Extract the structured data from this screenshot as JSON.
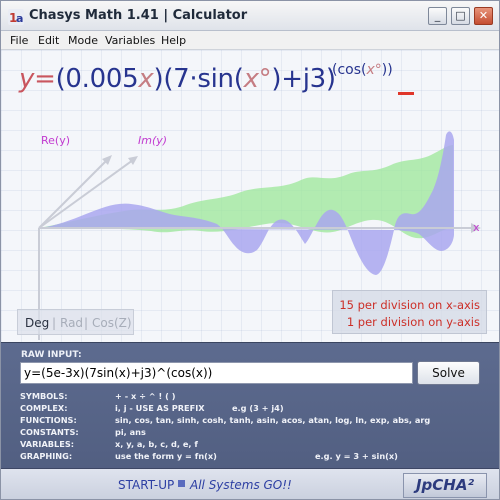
{
  "window": {
    "title": "Chasys Math 1.41 | Calculator",
    "controls": {
      "minimize": "_",
      "maximize": "□",
      "close": "✕"
    }
  },
  "menu": [
    "File",
    "Edit",
    "Mode",
    "Variables",
    "Help"
  ],
  "equation": {
    "y": "y",
    "eq": "=",
    "p1_open": "(0.005",
    "p1_x": "x",
    "p1_close": ")",
    "p2_open": "(7·sin(",
    "p2_x": "x°",
    "p2_close": ")+j3)",
    "exp_open": "(cos(",
    "exp_x": "x°",
    "exp_close": "))"
  },
  "graph": {
    "re_label": "Re(y)",
    "im_label": "Im(y)",
    "x_label": "x",
    "modes": {
      "deg": "Deg",
      "sep1": "|",
      "rad": "Rad",
      "sep2": "|",
      "cos": "Cos(Z)"
    },
    "scale": {
      "x_axis": "15 per division on x-axis",
      "y_axis": "1 per division on y-axis"
    }
  },
  "input": {
    "label": "RAW INPUT:",
    "value": "y=(5e-3x)(7sin(x)+j3)^(cos(x))",
    "solve_label": "Solve"
  },
  "help": [
    {
      "key": "SYMBOLS:",
      "value": "+ - x ÷ ^ ! ( )",
      "extra": ""
    },
    {
      "key": "COMPLEX:",
      "value": "i, j - USE AS PREFIX",
      "extra": "e.g (3 + j4)"
    },
    {
      "key": "FUNCTIONS:",
      "value": "sin, cos, tan, sinh, cosh, tanh, asin, acos, atan, log, ln, exp, abs, arg",
      "extra": ""
    },
    {
      "key": "CONSTANTS:",
      "value": "pi, ans",
      "extra": ""
    },
    {
      "key": "VARIABLES:",
      "value": "x, y, a, b, c, d, e, f",
      "extra": ""
    },
    {
      "key": "GRAPHING:",
      "value": "use the form y = fn(x)",
      "extra": "e.g. y = 3 + sin(x)"
    }
  ],
  "status": {
    "label": "START-UP",
    "value": "All Systems GO!!",
    "brand": "JpCHA²"
  },
  "colors": {
    "real_fill": "#9fe89c",
    "imag_fill": "#a9a7ee",
    "axis_label": "#c23bd0",
    "equation": "#27348f",
    "panel": "#566386"
  }
}
